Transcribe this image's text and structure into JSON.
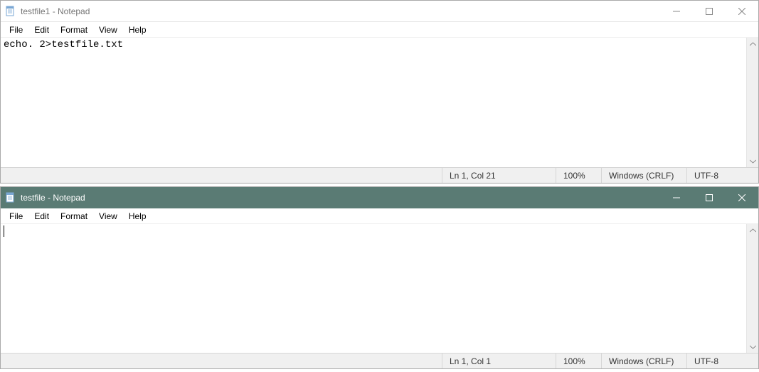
{
  "window1": {
    "title": "testfile1 - Notepad",
    "menus": [
      "File",
      "Edit",
      "Format",
      "View",
      "Help"
    ],
    "content": "echo. 2>testfile.txt",
    "status": {
      "pos": "Ln 1, Col 21",
      "zoom": "100%",
      "eol": "Windows (CRLF)",
      "enc": "UTF-8"
    }
  },
  "window2": {
    "title": "testfile - Notepad",
    "menus": [
      "File",
      "Edit",
      "Format",
      "View",
      "Help"
    ],
    "content": "",
    "status": {
      "pos": "Ln 1, Col 1",
      "zoom": "100%",
      "eol": "Windows (CRLF)",
      "enc": "UTF-8"
    }
  }
}
